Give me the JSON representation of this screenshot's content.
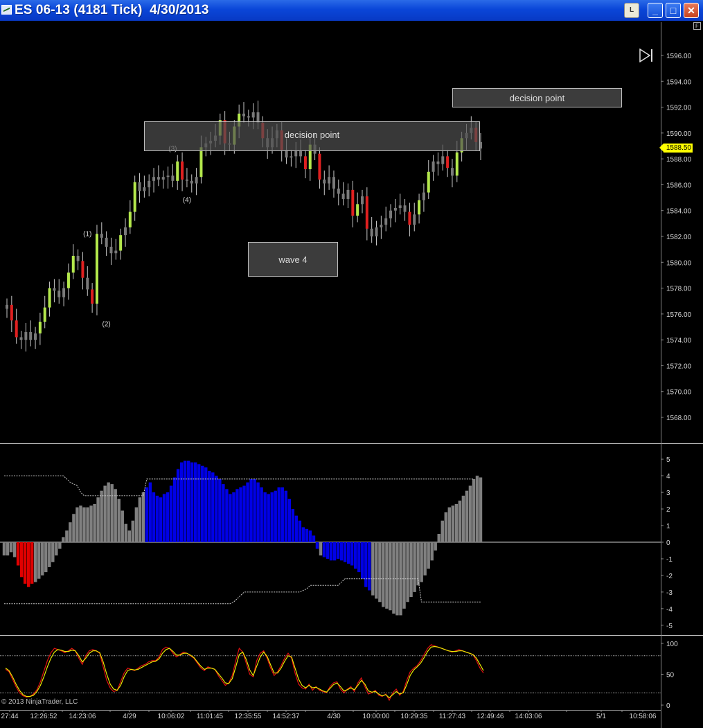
{
  "window": {
    "title": "ES 06-13 (4181 Tick)  4/30/2013",
    "btn_l": "L",
    "btn_min": "_",
    "btn_max": "□",
    "btn_close": "✕"
  },
  "price_panel": {
    "y_ticks": [
      "1596.00",
      "1594.00",
      "1592.00",
      "1590.00",
      "1588.00",
      "1586.00",
      "1584.00",
      "1582.00",
      "1580.00",
      "1578.00",
      "1576.00",
      "1574.00",
      "1572.00",
      "1570.00",
      "1568.00"
    ],
    "last_price": "1588.50",
    "f_button": "F",
    "annotations": [
      {
        "id": "decision-1",
        "text": "decision point"
      },
      {
        "id": "decision-2",
        "text": "decision point"
      },
      {
        "id": "wave4",
        "text": "wave 4"
      }
    ],
    "wave_labels": [
      "(1)",
      "(2)",
      "(3)",
      "(4)"
    ]
  },
  "histogram_panel": {
    "y_ticks": [
      "5",
      "4",
      "3",
      "2",
      "1",
      "0",
      "-1",
      "-2",
      "-3",
      "-4",
      "-5"
    ]
  },
  "stochastic_panel": {
    "y_ticks": [
      "100",
      "50",
      "0"
    ]
  },
  "x_axis": {
    "labels": [
      "27:44",
      "12:26:52",
      "14:23:06",
      "4/29",
      "10:06:02",
      "11:01:45",
      "12:35:55",
      "14:52:37",
      "4/30",
      "10:00:00",
      "10:29:35",
      "11:27:43",
      "12:49:46",
      "14:03:06",
      "5/1",
      "10:58:06"
    ]
  },
  "footer": {
    "copyright": "© 2013 NinjaTrader, LLC"
  },
  "colors": {
    "up_green": "#b4e84c",
    "down_red": "#e02020",
    "neutral_gray": "#7a7a7a",
    "hist_blue": "#0000e6",
    "hist_red": "#e00000",
    "hist_gray": "#808080",
    "stoch_k": "#e01010",
    "stoch_d": "#e8e800",
    "title_bar": "#0a46d8"
  },
  "chart_data": [
    {
      "type": "candlestick",
      "ylim": [
        1566.5,
        1597.5
      ],
      "closes": [
        1576.7,
        1575.5,
        1574.2,
        1574.0,
        1574.6,
        1574.0,
        1574.5,
        1575.4,
        1576.5,
        1578.0,
        1577.8,
        1577.3,
        1578.0,
        1579.2,
        1580.5,
        1580.1,
        1578.8,
        1577.9,
        1576.8,
        1582.2,
        1581.9,
        1581.2,
        1580.7,
        1580.9,
        1582.1,
        1582.7,
        1583.9,
        1586.2,
        1585.5,
        1585.8,
        1586.3,
        1586.6,
        1586.4,
        1586.6,
        1586.7,
        1586.3,
        1587.8,
        1586.4,
        1586.3,
        1586.1,
        1586.6,
        1588.9,
        1589.2,
        1589.4,
        1589.8,
        1591.0,
        1589.2,
        1589.1,
        1590.5,
        1591.5,
        1591.3,
        1591.2,
        1591.6,
        1590.8,
        1589.6,
        1588.9,
        1589.6,
        1590.2,
        1588.7,
        1588.1,
        1588.2,
        1588.6,
        1588.2,
        1587.2,
        1589.1,
        1588.4,
        1586.4,
        1586.1,
        1586.6,
        1585.7,
        1585.3,
        1584.9,
        1585.6,
        1583.6,
        1584.5,
        1585.1,
        1582.6,
        1582.0,
        1582.7,
        1582.9,
        1583.4,
        1584.0,
        1584.2,
        1584.4,
        1583.9,
        1582.9,
        1583.7,
        1584.8,
        1585.4,
        1587.0,
        1587.8,
        1587.6,
        1588.2,
        1587.3,
        1586.7,
        1588.5,
        1589.6,
        1590.0,
        1590.4,
        1589.3,
        1588.8
      ],
      "wave_marks": [
        {
          "label": "(1)",
          "value": 1581.5
        },
        {
          "label": "(2)",
          "value": 1575.9
        },
        {
          "label": "(3)",
          "value": 1588.1
        },
        {
          "label": "(4)",
          "value": 1585.5
        }
      ],
      "boxes": [
        {
          "text": "decision point",
          "y_top": 1592.5,
          "y_bottom": 1590.2
        },
        {
          "text": "decision point",
          "y_top": 1595.1,
          "y_bottom": 1593.6
        },
        {
          "text": "wave 4",
          "y_top": 1583.2,
          "y_bottom": 1580.5
        }
      ]
    },
    {
      "type": "bar",
      "ylim": [
        -5.3,
        5.3
      ],
      "values": [
        -0.8,
        -0.8,
        -0.6,
        -0.9,
        -1.4,
        -2.1,
        -2.5,
        -2.7,
        -2.5,
        -2.4,
        -2.2,
        -2.0,
        -1.8,
        -1.5,
        -1.2,
        -0.8,
        -0.4,
        0.3,
        0.7,
        1.2,
        1.7,
        2.1,
        2.2,
        2.1,
        2.1,
        2.2,
        2.3,
        2.7,
        3.1,
        3.4,
        3.6,
        3.5,
        3.2,
        2.6,
        1.9,
        1.1,
        0.7,
        1.3,
        2.1,
        2.7,
        3.0,
        3.3,
        3.6,
        3.0,
        2.8,
        2.7,
        2.9,
        3.0,
        3.4,
        3.9,
        4.4,
        4.8,
        4.9,
        4.9,
        4.8,
        4.8,
        4.7,
        4.6,
        4.5,
        4.3,
        4.2,
        4.0,
        3.8,
        3.5,
        3.2,
        2.9,
        3.0,
        3.2,
        3.3,
        3.4,
        3.6,
        3.8,
        3.8,
        3.6,
        3.3,
        3.0,
        2.9,
        3.0,
        3.1,
        3.3,
        3.3,
        3.1,
        2.6,
        2.0,
        1.6,
        1.3,
        0.9,
        0.8,
        0.7,
        0.4,
        -0.4,
        -0.8,
        -0.9,
        -1.0,
        -1.1,
        -1.1,
        -1.0,
        -1.1,
        -1.2,
        -1.3,
        -1.4,
        -1.6,
        -1.8,
        -2.2,
        -2.7,
        -2.9,
        -3.2,
        -3.4,
        -3.6,
        -3.9,
        -4.0,
        -4.1,
        -4.3,
        -4.4,
        -4.4,
        -4.0,
        -3.6,
        -3.3,
        -3.0,
        -2.6,
        -2.4,
        -2.0,
        -1.6,
        -1.1,
        -0.5,
        0.5,
        1.3,
        1.8,
        2.1,
        2.2,
        2.3,
        2.5,
        2.8,
        3.1,
        3.4,
        3.8,
        4.0,
        3.9
      ],
      "colors": [
        "gray",
        "gray",
        "gray",
        "gray",
        "red",
        "red",
        "red",
        "red",
        "red",
        "gray",
        "gray",
        "gray",
        "gray",
        "gray",
        "gray",
        "gray",
        "gray",
        "gray",
        "gray",
        "gray",
        "gray",
        "gray",
        "gray",
        "gray",
        "gray",
        "gray",
        "gray",
        "gray",
        "gray",
        "gray",
        "gray",
        "gray",
        "gray",
        "gray",
        "gray",
        "gray",
        "gray",
        "gray",
        "gray",
        "gray",
        "gray",
        "blue",
        "blue",
        "blue",
        "blue",
        "blue",
        "blue",
        "blue",
        "blue",
        "blue",
        "blue",
        "blue",
        "blue",
        "blue",
        "blue",
        "blue",
        "blue",
        "blue",
        "blue",
        "blue",
        "blue",
        "blue",
        "blue",
        "blue",
        "blue",
        "blue",
        "blue",
        "blue",
        "blue",
        "blue",
        "blue",
        "blue",
        "blue",
        "blue",
        "blue",
        "blue",
        "blue",
        "blue",
        "blue",
        "blue",
        "blue",
        "blue",
        "blue",
        "blue",
        "blue",
        "blue",
        "blue",
        "blue",
        "blue",
        "blue",
        "blue",
        "gray",
        "blue",
        "blue",
        "blue",
        "blue",
        "blue",
        "blue",
        "blue",
        "blue",
        "blue",
        "blue",
        "blue",
        "blue",
        "blue",
        "blue",
        "gray",
        "gray",
        "gray",
        "gray",
        "gray",
        "gray",
        "gray",
        "gray",
        "gray",
        "gray",
        "gray",
        "gray",
        "gray",
        "gray",
        "gray",
        "gray",
        "gray",
        "gray",
        "gray",
        "gray",
        "gray",
        "gray",
        "gray",
        "gray",
        "gray",
        "gray",
        "gray",
        "gray",
        "gray",
        "gray",
        "gray",
        "gray",
        "blue"
      ],
      "upper_band": [
        4.0,
        4.0,
        4.0,
        4.0,
        4.0,
        4.0,
        4.0,
        4.0,
        4.0,
        4.0,
        4.0,
        4.0,
        4.0,
        4.0,
        4.0,
        4.0,
        4.0,
        4.0,
        3.8,
        3.6,
        3.5,
        3.4,
        3.0,
        2.8,
        2.8,
        2.8,
        2.8,
        2.8,
        2.8,
        2.8,
        2.8,
        2.8,
        2.8,
        2.8,
        2.8,
        2.8,
        2.8,
        2.8,
        2.8,
        2.8,
        2.8,
        3.8,
        3.8,
        3.8,
        3.8,
        3.8,
        3.8,
        3.8,
        3.8,
        3.8,
        3.8,
        3.8,
        3.8,
        3.8,
        3.8,
        3.8,
        3.8,
        3.8,
        3.8,
        3.8,
        3.8,
        3.8,
        3.8,
        3.8,
        3.8,
        3.8,
        3.8,
        3.8,
        3.8,
        3.8,
        3.8,
        3.8,
        3.8,
        3.8,
        3.8,
        3.8,
        3.8,
        3.8,
        3.8,
        3.8,
        3.8,
        3.8,
        3.8,
        3.8,
        3.8,
        3.8,
        3.8,
        3.8,
        3.8,
        3.8,
        3.8,
        3.8,
        3.8,
        3.8,
        3.8,
        3.8,
        3.8,
        3.8,
        3.8,
        3.8,
        3.8,
        3.8,
        3.8,
        3.8,
        3.8,
        3.8,
        3.8,
        3.8,
        3.8,
        3.8,
        3.8,
        3.8,
        3.8,
        3.8,
        3.8,
        3.8,
        3.8,
        3.8,
        3.8,
        3.8,
        3.8,
        3.8,
        3.8,
        3.8,
        3.8,
        3.8,
        3.8,
        3.8,
        3.8,
        3.8,
        3.8,
        3.8,
        3.8,
        3.8,
        3.8,
        3.8
      ],
      "lower_band": [
        -3.7,
        -3.7,
        -3.7,
        -3.7,
        -3.7,
        -3.7,
        -3.7,
        -3.7,
        -3.7,
        -3.7,
        -3.7,
        -3.7,
        -3.7,
        -3.7,
        -3.7,
        -3.7,
        -3.7,
        -3.7,
        -3.7,
        -3.7,
        -3.7,
        -3.7,
        -3.7,
        -3.7,
        -3.7,
        -3.7,
        -3.7,
        -3.7,
        -3.7,
        -3.7,
        -3.7,
        -3.7,
        -3.7,
        -3.7,
        -3.7,
        -3.7,
        -3.7,
        -3.7,
        -3.7,
        -3.7,
        -3.7,
        -3.7,
        -3.7,
        -3.7,
        -3.7,
        -3.7,
        -3.7,
        -3.7,
        -3.7,
        -3.7,
        -3.7,
        -3.7,
        -3.7,
        -3.7,
        -3.7,
        -3.7,
        -3.7,
        -3.7,
        -3.7,
        -3.7,
        -3.7,
        -3.7,
        -3.7,
        -3.7,
        -3.7,
        -3.7,
        -3.6,
        -3.4,
        -3.2,
        -3.0,
        -3.0,
        -3.0,
        -3.0,
        -3.0,
        -3.0,
        -3.0,
        -3.0,
        -3.0,
        -3.0,
        -3.0,
        -3.0,
        -3.0,
        -3.0,
        -3.0,
        -3.0,
        -3.0,
        -2.9,
        -2.8,
        -2.6,
        -2.6,
        -2.6,
        -2.6,
        -2.6,
        -2.6,
        -2.6,
        -2.6,
        -2.6,
        -2.4,
        -2.2,
        -2.2,
        -2.2,
        -2.2,
        -2.2,
        -2.2,
        -2.2,
        -2.2,
        -2.2,
        -2.2,
        -2.2,
        -2.2,
        -2.2,
        -2.2,
        -2.2,
        -2.2,
        -2.2,
        -2.2,
        -2.2,
        -2.2,
        -2.2,
        -2.2,
        -3.6,
        -3.6,
        -3.6,
        -3.6,
        -3.6,
        -3.6,
        -3.6,
        -3.6,
        -3.6,
        -3.6,
        -3.6,
        -3.6,
        -3.6,
        -3.6,
        -3.6,
        -3.6,
        -3.6,
        -3.6
      ]
    },
    {
      "type": "line",
      "ylim": [
        0,
        100
      ],
      "levels": [
        80,
        20
      ],
      "series": [
        {
          "values": [
            58,
            54,
            42,
            30,
            20,
            15,
            13,
            14,
            18,
            25,
            38,
            55,
            72,
            85,
            92,
            90,
            88,
            85,
            88,
            92,
            88,
            76,
            66,
            80,
            88,
            90,
            88,
            84,
            62,
            40,
            28,
            22,
            24,
            38,
            52,
            60,
            58,
            56,
            60,
            64,
            66,
            70,
            72,
            72,
            78,
            90,
            94,
            92,
            84,
            78,
            82,
            86,
            84,
            80,
            76,
            68,
            60,
            56,
            62,
            60,
            58,
            48,
            40,
            32,
            36,
            48,
            72,
            92,
            86,
            68,
            50,
            46,
            72,
            84,
            88,
            76,
            60,
            48,
            54,
            64,
            76,
            84,
            76,
            52,
            34,
            28,
            26,
            34,
            24,
            30,
            24,
            22,
            20,
            30,
            36,
            38,
            26,
            20,
            26,
            30,
            22,
            36,
            44,
            30,
            18,
            20,
            24,
            16,
            14,
            18,
            8,
            20,
            26,
            16,
            22,
            40,
            54,
            60,
            64,
            72,
            82,
            92,
            98,
            96,
            94,
            92,
            90,
            88,
            86,
            88,
            90,
            88,
            86,
            84,
            82,
            72,
            60,
            52
          ]
        },
        {
          "values": [
            60,
            56,
            46,
            34,
            24,
            17,
            14,
            14,
            16,
            22,
            32,
            46,
            62,
            76,
            86,
            90,
            89,
            87,
            87,
            89,
            88,
            80,
            70,
            76,
            84,
            88,
            88,
            85,
            70,
            50,
            34,
            26,
            24,
            32,
            46,
            56,
            58,
            57,
            58,
            61,
            64,
            67,
            70,
            71,
            75,
            84,
            90,
            92,
            87,
            81,
            81,
            84,
            84,
            81,
            77,
            70,
            63,
            58,
            60,
            60,
            58,
            51,
            44,
            36,
            35,
            43,
            62,
            82,
            86,
            74,
            57,
            48,
            63,
            78,
            86,
            79,
            65,
            52,
            52,
            60,
            71,
            80,
            78,
            60,
            42,
            32,
            28,
            32,
            28,
            29,
            26,
            23,
            21,
            27,
            33,
            36,
            30,
            23,
            25,
            28,
            25,
            32,
            40,
            34,
            23,
            21,
            22,
            18,
            15,
            17,
            12,
            17,
            22,
            18,
            20,
            33,
            48,
            57,
            62,
            68,
            77,
            87,
            94,
            95,
            94,
            92,
            90,
            88,
            87,
            87,
            88,
            88,
            86,
            84,
            82,
            76,
            66,
            56
          ]
        }
      ]
    }
  ]
}
